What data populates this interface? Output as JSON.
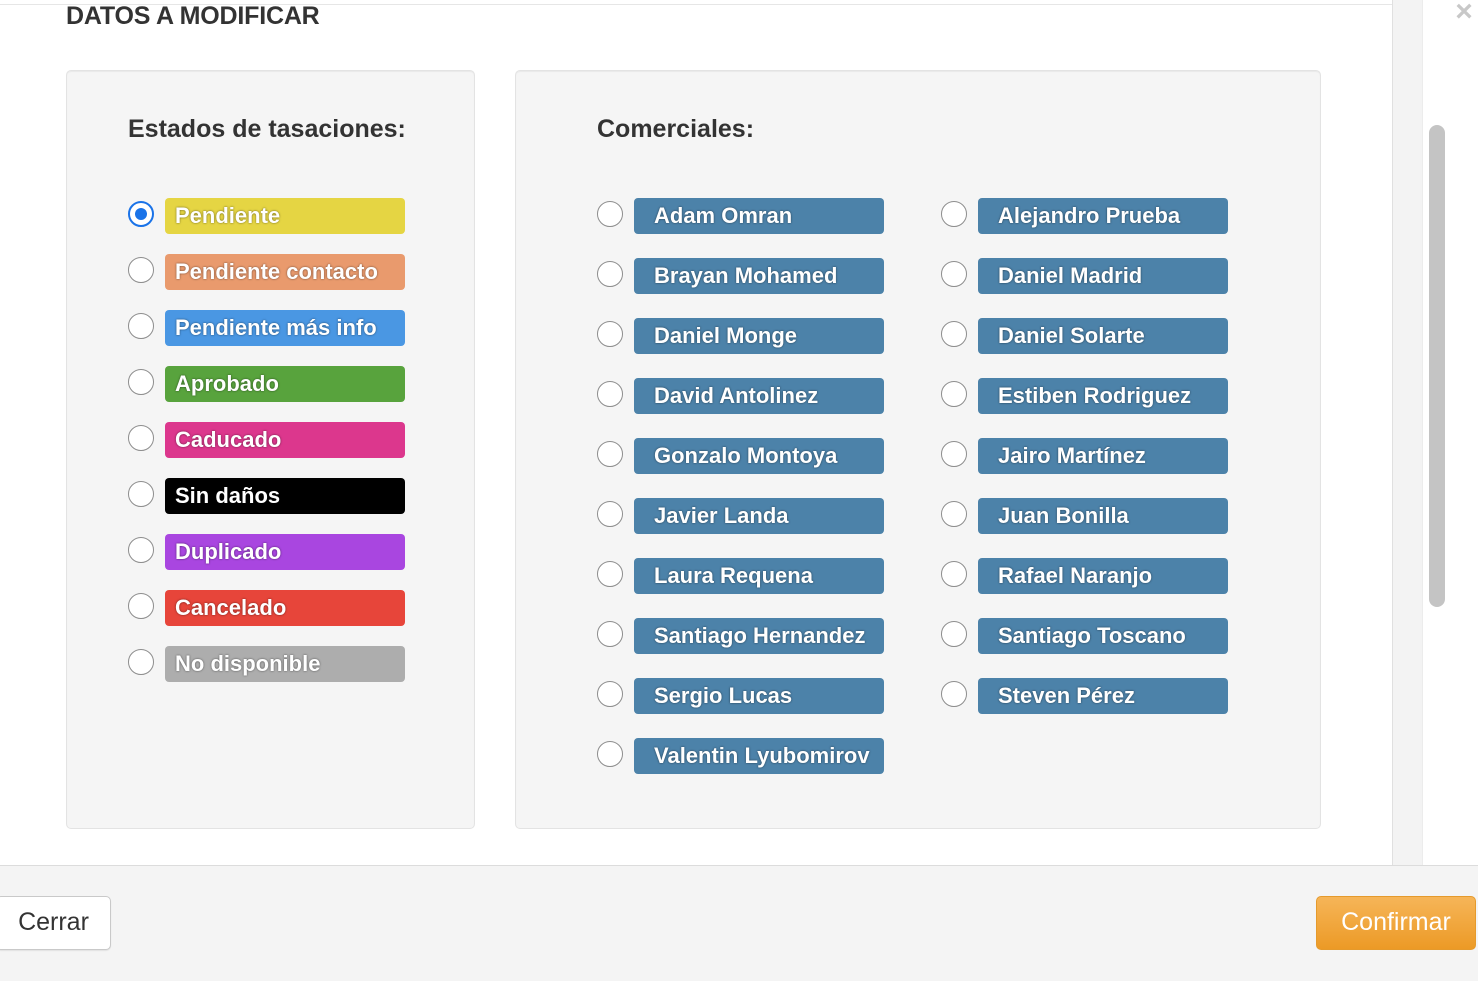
{
  "header": {
    "title": "DATOS A MODIFICAR",
    "close_symbol": "×"
  },
  "estados": {
    "title": "Estados de tasaciones:",
    "items": [
      {
        "label": "Pendiente",
        "color": "#e5d543",
        "checked": true
      },
      {
        "label": "Pendiente contacto",
        "color": "#e99a6d",
        "checked": false
      },
      {
        "label": "Pendiente más info",
        "color": "#4a97e3",
        "checked": false
      },
      {
        "label": "Aprobado",
        "color": "#58a33d",
        "checked": false
      },
      {
        "label": "Caducado",
        "color": "#dc378d",
        "checked": false
      },
      {
        "label": "Sin daños",
        "color": "#000000",
        "checked": false
      },
      {
        "label": "Duplicado",
        "color": "#a946e0",
        "checked": false
      },
      {
        "label": "Cancelado",
        "color": "#e7453a",
        "checked": false
      },
      {
        "label": "No disponible",
        "color": "#adadad",
        "checked": false
      }
    ]
  },
  "comerciales": {
    "title": "Comerciales:",
    "color": "#4c82a9",
    "left_column": [
      "Adam Omran",
      "Brayan Mohamed",
      "Daniel Monge",
      "David Antolinez",
      "Gonzalo Montoya",
      "Javier Landa",
      "Laura Requena",
      "Santiago Hernandez",
      "Sergio Lucas",
      "Valentin Lyubomirov"
    ],
    "right_column": [
      "Alejandro Prueba",
      "Daniel Madrid",
      "Daniel Solarte",
      "Estiben Rodriguez",
      "Jairo Martínez",
      "Juan Bonilla",
      "Rafael Naranjo",
      "Santiago Toscano",
      "Steven Pérez"
    ]
  },
  "footer": {
    "close_label": "Cerrar",
    "confirm_label": "Confirmar",
    "confirm_color": "#f0ad4e"
  }
}
